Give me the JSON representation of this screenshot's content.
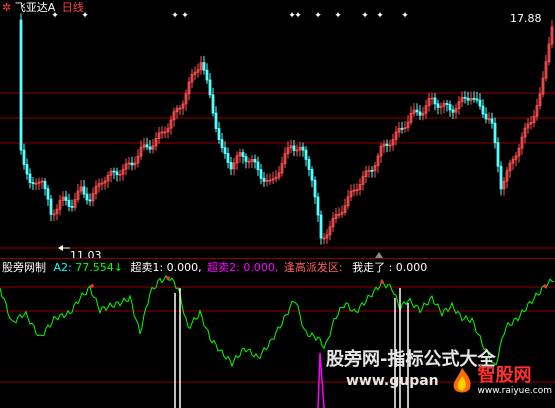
{
  "header": {
    "symbol_icon": "gear-icon",
    "stock_name": "飞亚达A",
    "period": "日线"
  },
  "price_panel": {
    "high_label": "17.88",
    "low_label": "11.03",
    "colors": {
      "up": "#ff5050",
      "down": "#54ffff",
      "grid": "#8b0000",
      "signal": "#ffffff"
    }
  },
  "indicator": {
    "name": "股旁网制",
    "a2_label": "A2:",
    "a2_value": "77.554",
    "a2_arrow": "↓",
    "overbuy_label": "超卖1:",
    "overbuy_value": "0.000,",
    "overbuy2_label": "超卖2:",
    "overbuy2_value": "0.000,",
    "breakout_label": "逢高派发区:",
    "walk_label": "我走了",
    "walk_value": ": 0.000",
    "colors": {
      "line": "#00ff00",
      "label": "#00ffff",
      "overbuy1": "#ffffff",
      "overbuy2": "#ff00ff",
      "breakout": "#ff6060"
    }
  },
  "watermark": {
    "text_cn": "股旁网-指标公式大全",
    "url": "www.gupan",
    "logo_text": "智股网",
    "logo_url": "www.raiyue.com"
  }
}
